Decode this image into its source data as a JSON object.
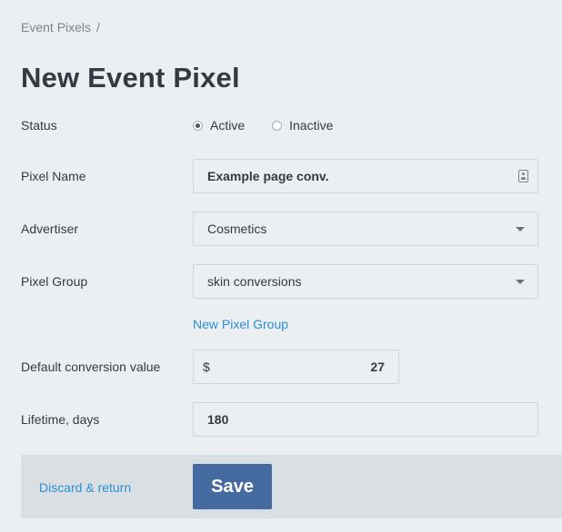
{
  "breadcrumb": {
    "item": "Event Pixels",
    "separator": "/"
  },
  "title": "New Event Pixel",
  "form": {
    "status": {
      "label": "Status",
      "options": [
        {
          "label": "Active",
          "checked": true
        },
        {
          "label": "Inactive",
          "checked": false
        }
      ]
    },
    "pixel_name": {
      "label": "Pixel Name",
      "value": "Example page conv.",
      "icon": "contact-card-icon"
    },
    "advertiser": {
      "label": "Advertiser",
      "value": "Cosmetics",
      "icon": "chevron-down-icon"
    },
    "pixel_group": {
      "label": "Pixel Group",
      "value": "skin conversions",
      "icon": "chevron-down-icon",
      "new_link": "New Pixel Group"
    },
    "default_conversion_value": {
      "label": "Default conversion value",
      "currency": "$",
      "value": "27"
    },
    "lifetime": {
      "label": "Lifetime, days",
      "value": "180"
    }
  },
  "footer": {
    "discard_label": "Discard & return",
    "save_label": "Save"
  },
  "colors": {
    "background": "#eceff1",
    "footer": "#d9dfe3",
    "primary_button": "#456aa0",
    "link": "#2a8fd6"
  }
}
